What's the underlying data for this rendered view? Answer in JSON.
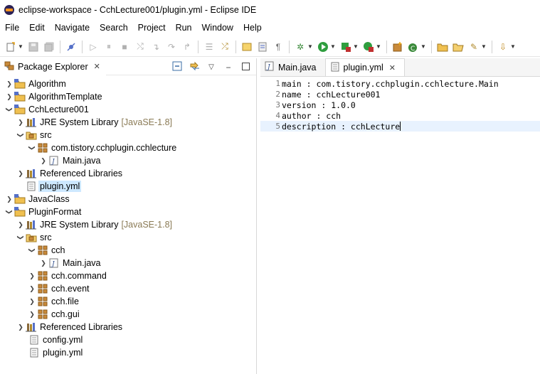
{
  "window": {
    "title": "eclipse-workspace - CchLecture001/plugin.yml - Eclipse IDE"
  },
  "menu": [
    "File",
    "Edit",
    "Navigate",
    "Search",
    "Project",
    "Run",
    "Window",
    "Help"
  ],
  "package_explorer": {
    "tab_label": "Package Explorer",
    "tree": [
      {
        "label": "Algorithm",
        "icon": "project-icon"
      },
      {
        "label": "AlgorithmTemplate",
        "icon": "project-icon"
      },
      {
        "label": "CchLecture001",
        "icon": "project-icon"
      },
      {
        "label": "JRE System Library",
        "decor": "[JavaSE-1.8]",
        "icon": "library-icon"
      },
      {
        "label": "src",
        "icon": "source-folder-icon"
      },
      {
        "label": "com.tistory.cchplugin.cchlecture",
        "icon": "package-icon"
      },
      {
        "label": "Main.java",
        "icon": "java-file-icon"
      },
      {
        "label": "Referenced Libraries",
        "icon": "library-icon"
      },
      {
        "label": "plugin.yml",
        "icon": "text-file-icon"
      },
      {
        "label": "JavaClass",
        "icon": "project-icon"
      },
      {
        "label": "PluginFormat",
        "icon": "project-icon"
      },
      {
        "label": "JRE System Library",
        "decor": "[JavaSE-1.8]",
        "icon": "library-icon"
      },
      {
        "label": "src",
        "icon": "source-folder-icon"
      },
      {
        "label": "cch",
        "icon": "package-icon"
      },
      {
        "label": "Main.java",
        "icon": "java-file-icon"
      },
      {
        "label": "cch.command",
        "icon": "package-icon"
      },
      {
        "label": "cch.event",
        "icon": "package-icon"
      },
      {
        "label": "cch.file",
        "icon": "package-icon"
      },
      {
        "label": "cch.gui",
        "icon": "package-icon"
      },
      {
        "label": "Referenced Libraries",
        "icon": "library-icon"
      },
      {
        "label": "config.yml",
        "icon": "text-file-icon"
      },
      {
        "label": "plugin.yml",
        "icon": "text-file-icon"
      }
    ]
  },
  "editor": {
    "tabs": [
      {
        "label": "Main.java",
        "icon": "java-file-icon"
      },
      {
        "label": "plugin.yml",
        "icon": "text-file-icon"
      }
    ],
    "lines": [
      {
        "num": "1",
        "text": "main : com.tistory.cchplugin.cchlecture.Main"
      },
      {
        "num": "2",
        "text": "name : cchLecture001"
      },
      {
        "num": "3",
        "text": "version : 1.0.0"
      },
      {
        "num": "4",
        "text": "author : cch"
      },
      {
        "num": "5",
        "text": "description : cchLecture"
      }
    ]
  },
  "colors": {
    "selection": "#cde8ff",
    "current_line": "#e8f2fe",
    "accent": "#3a6ea5"
  }
}
